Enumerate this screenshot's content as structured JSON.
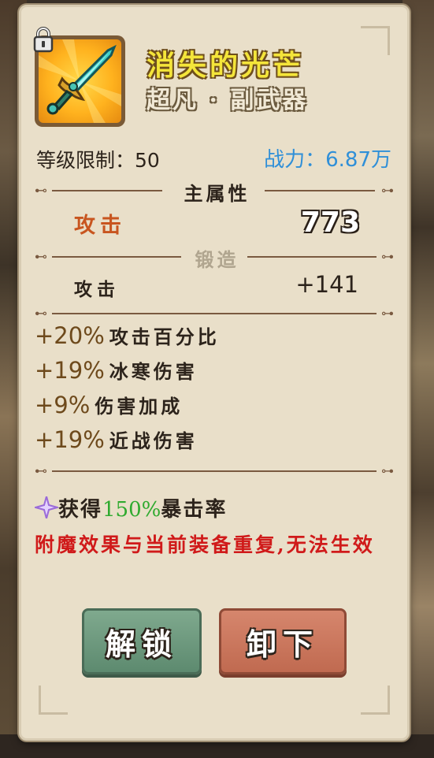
{
  "item": {
    "name": "消失的光芒",
    "quality": "超凡 · 副武器",
    "level_limit_label": "等级限制：",
    "level_limit_value": "50",
    "power_label": "战力：",
    "power_value": "6.87万"
  },
  "main_attr": {
    "section_title": "主属性",
    "stat_name": "攻击",
    "stat_value": "773"
  },
  "forge": {
    "section_title": "锻造",
    "stat_name": "攻击",
    "stat_value": "+141"
  },
  "affixes": [
    {
      "value": "+20%",
      "name": "攻击百分比"
    },
    {
      "value": "+19%",
      "name": "冰寒伤害"
    },
    {
      "value": "+9%",
      "name": "伤害加成"
    },
    {
      "value": "+19%",
      "name": "近战伤害"
    }
  ],
  "enchant": {
    "prefix": "获得",
    "value": "150%",
    "suffix": "暴击率",
    "warning": "附魔效果与当前装备重复,无法生效"
  },
  "buttons": {
    "unlock": "解锁",
    "remove": "卸下"
  },
  "colors": {
    "title": "#f4e53a",
    "power": "#2f8fd8",
    "main_stat_name": "#c8551f",
    "enchant_value": "#2faa2f",
    "warning": "#d01a1a",
    "unlock_button": "#6e987e",
    "remove_button": "#cc785e"
  }
}
